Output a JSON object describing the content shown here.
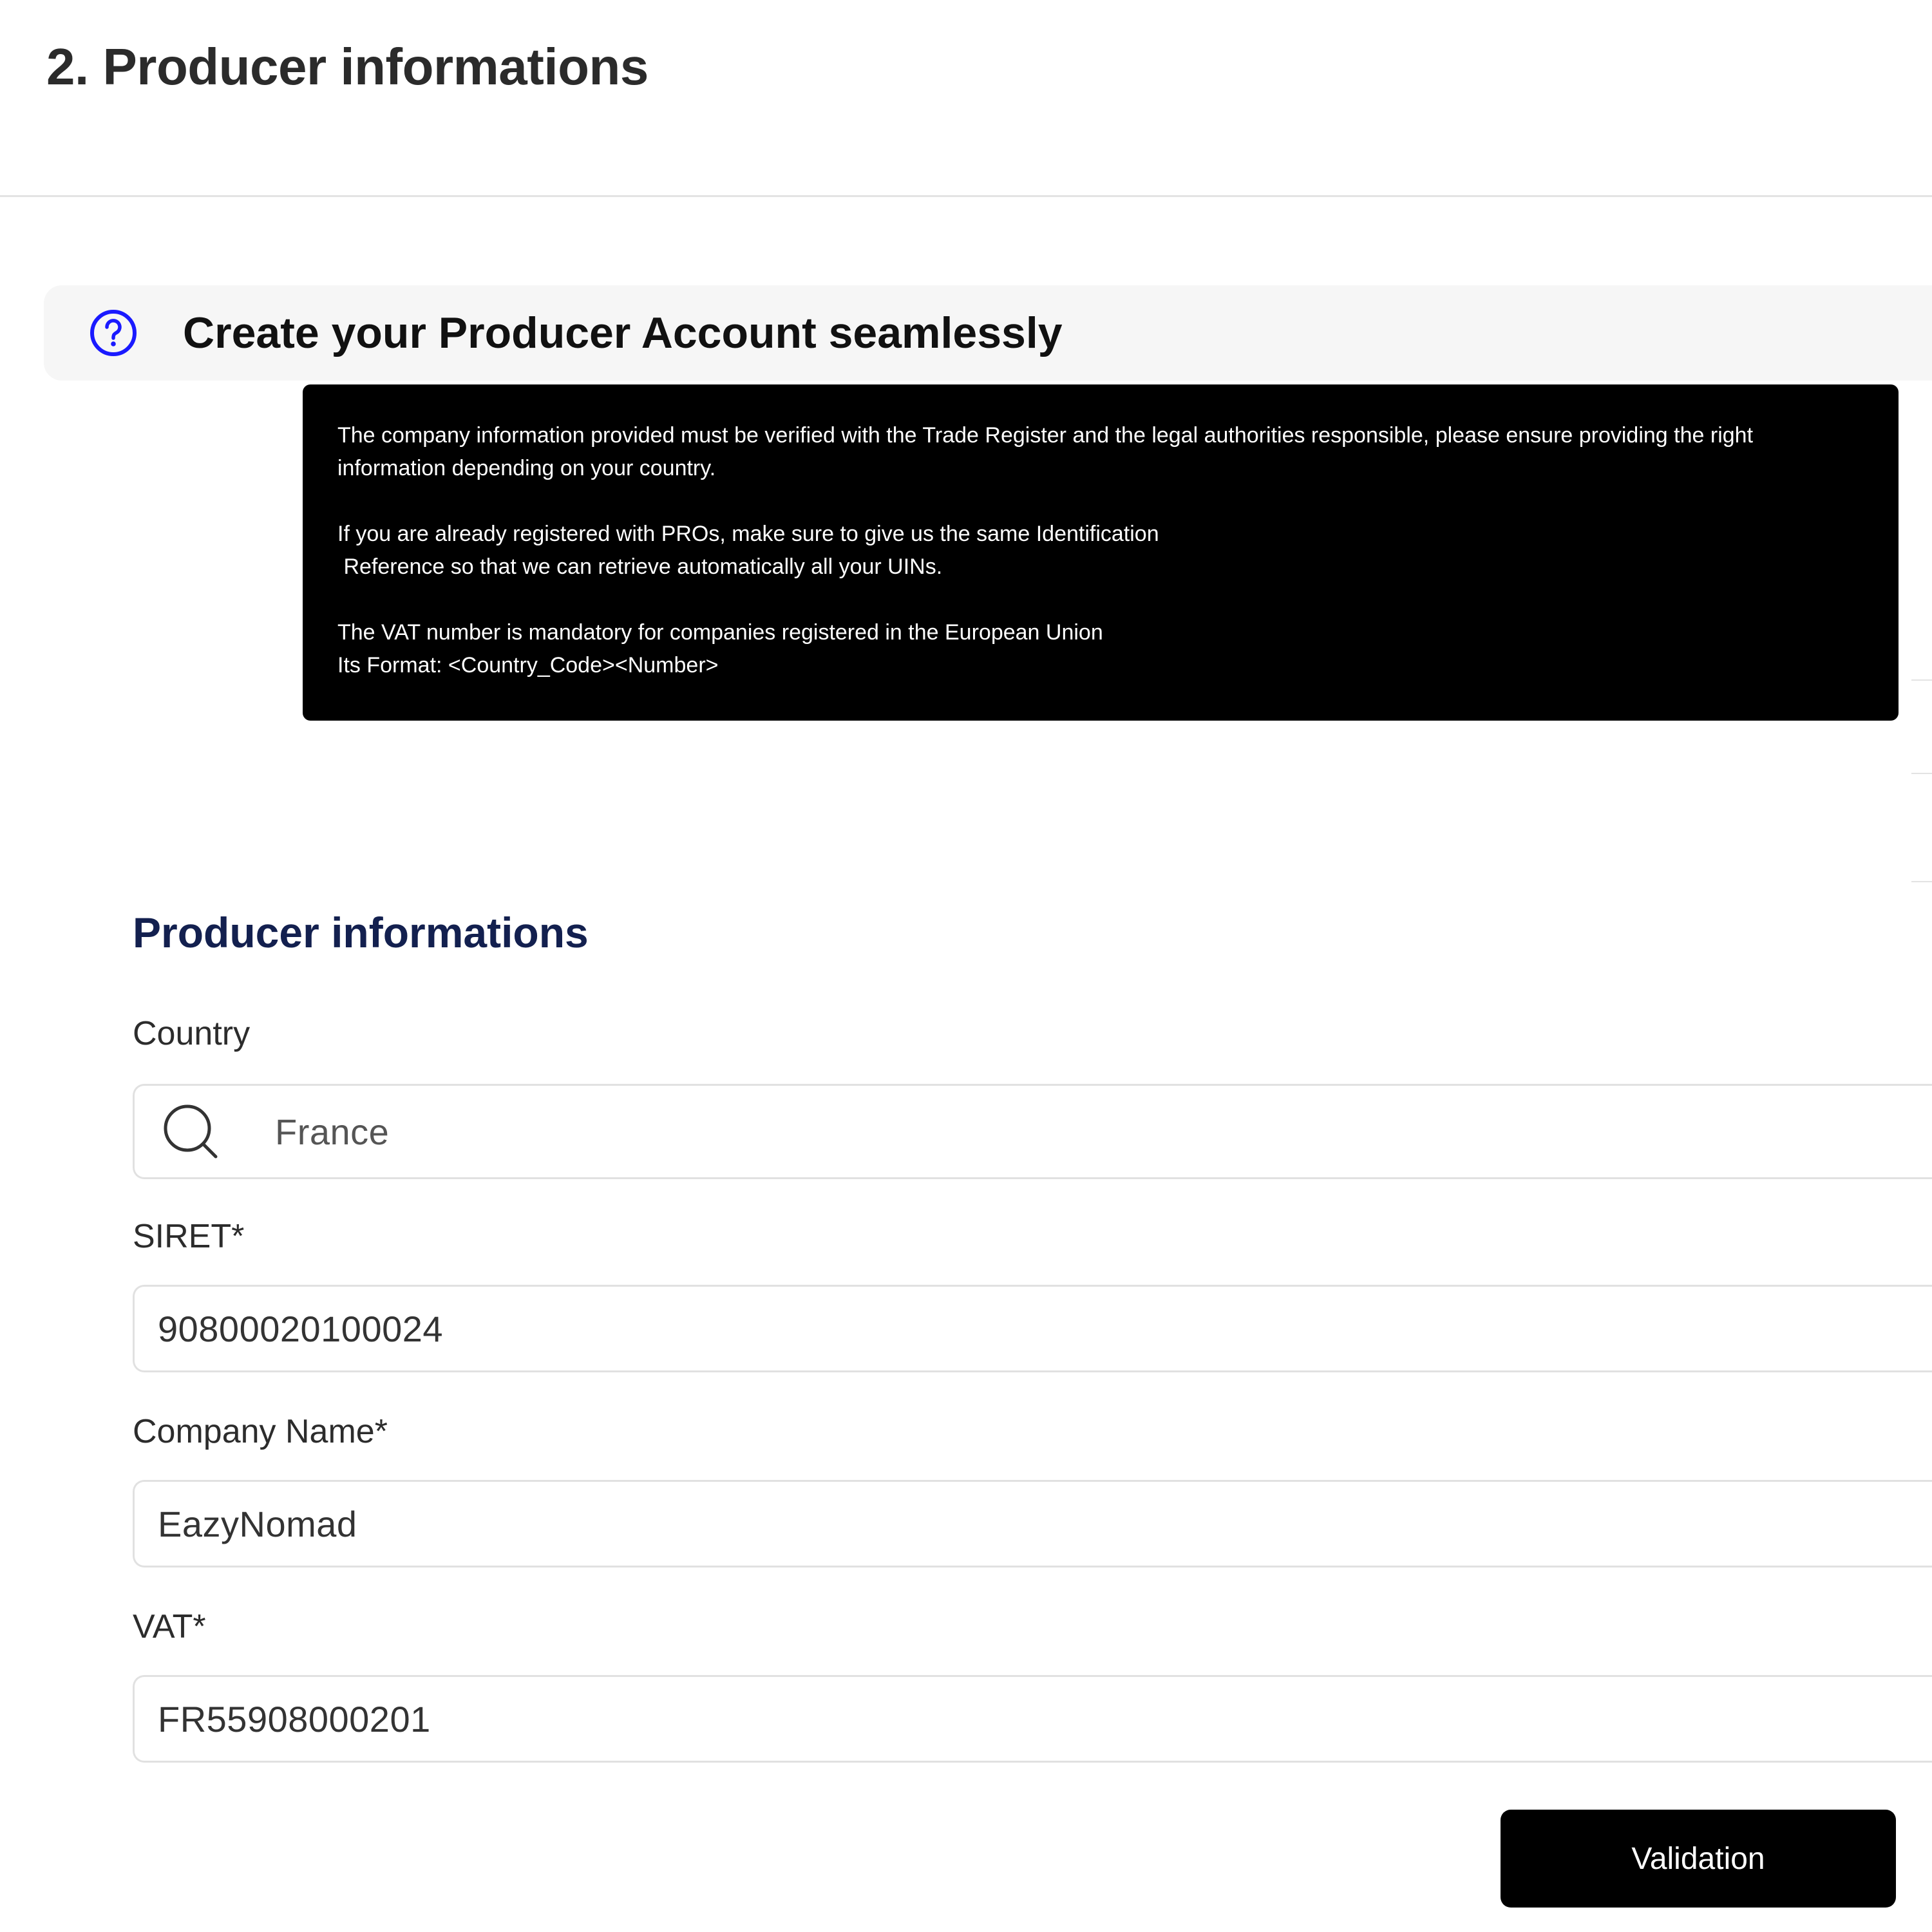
{
  "header": {
    "title": "2. Producer informations"
  },
  "help": {
    "title": "Create your Producer Account seamlessly",
    "tooltip_lines": [
      "The company information provided must be verified with the Trade Register and the legal authorities responsible, please ensure providing the right",
      "information depending on your country.",
      "If you are already registered with PROs, make sure to give us the same Identification",
      " Reference so that we can retrieve automatically all your UINs.",
      "The VAT number is mandatory for companies registered in the European Union",
      "Its Format: <Country_Code><Number>"
    ]
  },
  "form": {
    "section_title": "Producer informations",
    "country": {
      "label": "Country",
      "value": "France",
      "icon": "search-icon"
    },
    "siret": {
      "label": "SIRET*",
      "value": "90800020100024"
    },
    "company_name": {
      "label": "Company Name*",
      "value": "EazyNomad"
    },
    "vat": {
      "label": "VAT*",
      "value": "FR55908000201"
    },
    "submit_label": "Validation"
  },
  "colors": {
    "section_title": "#13204f",
    "help_icon": "#1a1aff",
    "button_bg": "#000000",
    "tooltip_bg": "#000000"
  }
}
